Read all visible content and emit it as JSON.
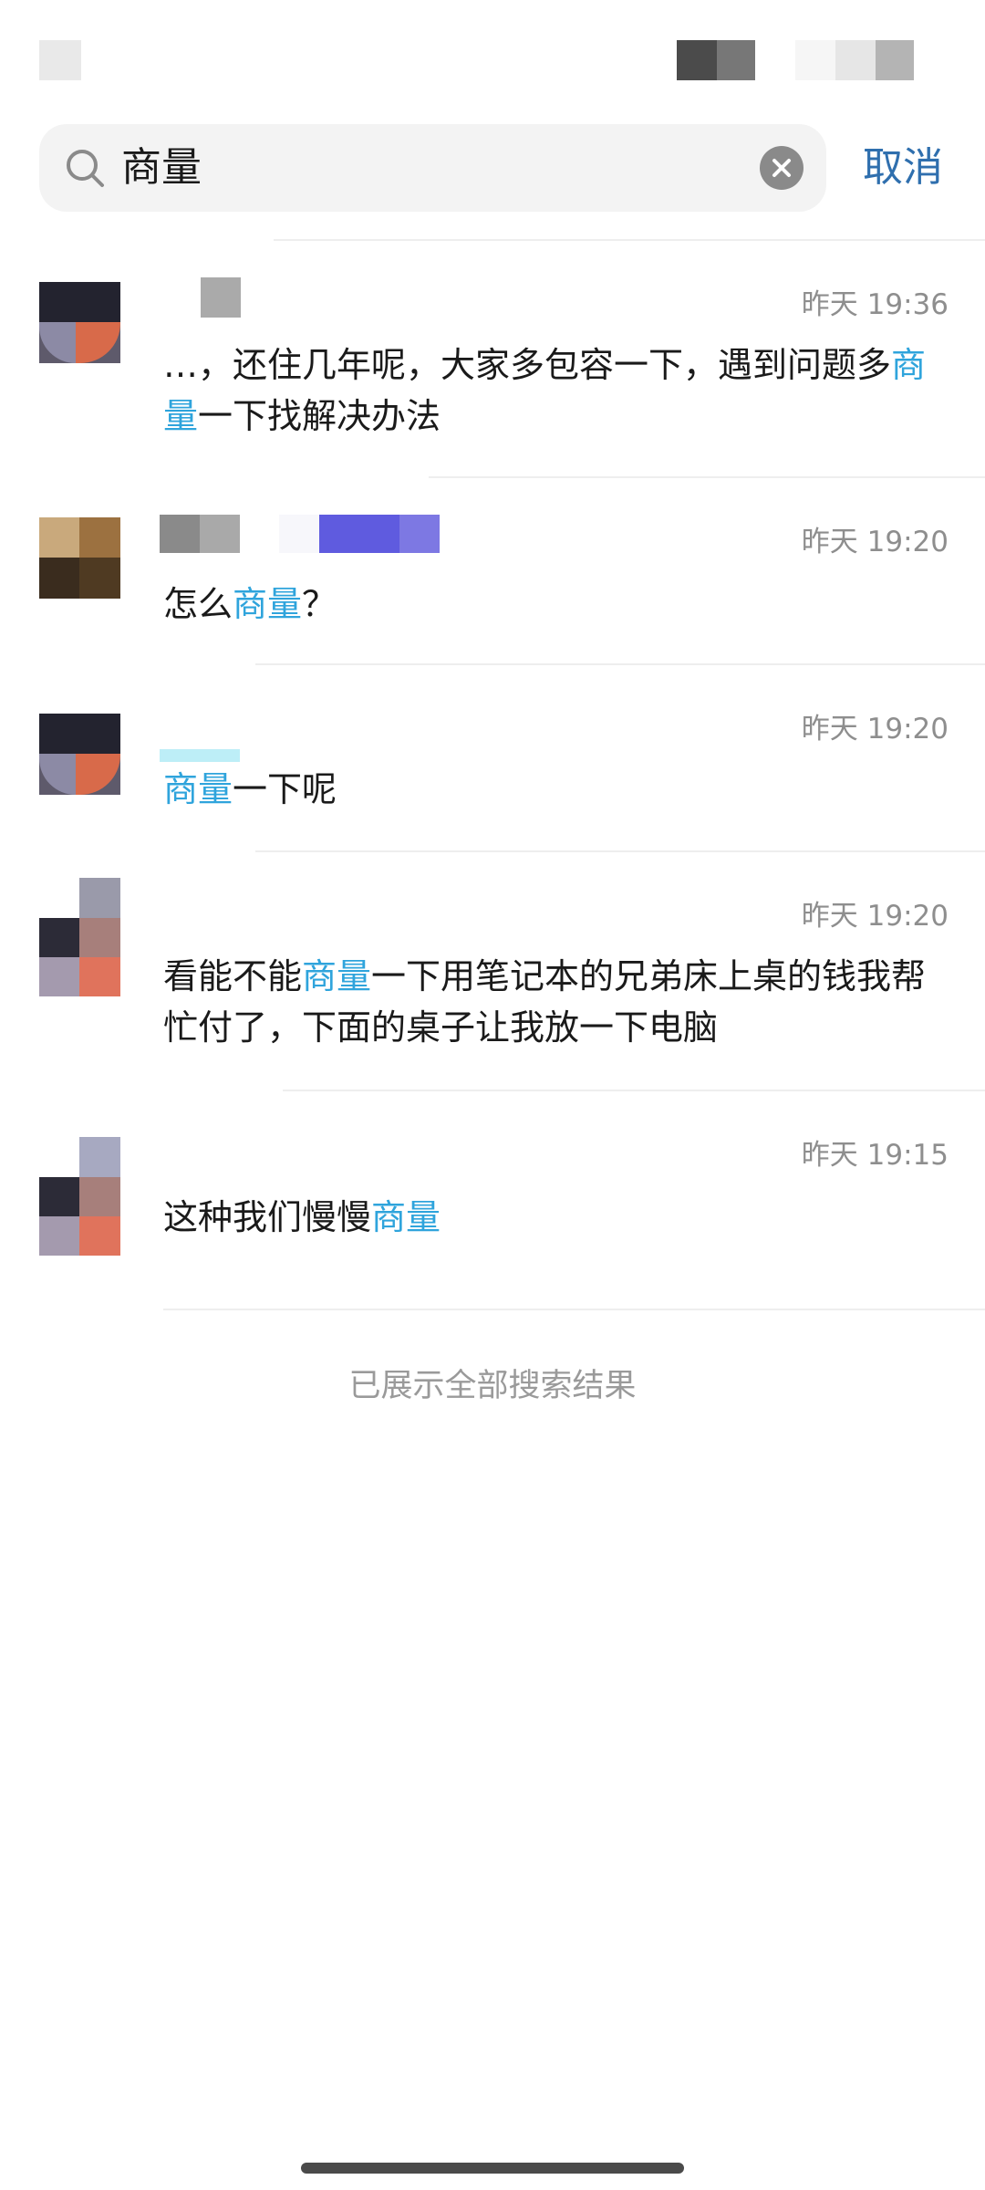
{
  "search": {
    "query": "商量",
    "cancel_label": "取消"
  },
  "results": [
    {
      "time": "昨天 19:36",
      "message_parts": [
        "…，还住几年呢，大家多包容一下，遇到问题多",
        "商量",
        "一下找解决办法"
      ]
    },
    {
      "time": "昨天 19:20",
      "message_parts": [
        "怎么",
        "商量",
        "？"
      ]
    },
    {
      "time": "昨天 19:20",
      "message_parts": [
        "",
        "商量",
        "一下呢"
      ]
    },
    {
      "time": "昨天 19:20",
      "message_parts": [
        "看能不能",
        "商量",
        "一下用笔记本的兄弟床上桌的钱我帮忙付了，下面的桌子让我放一下电脑"
      ]
    },
    {
      "time": "昨天 19:15",
      "message_parts": [
        "这种我们慢慢",
        "商量",
        ""
      ]
    }
  ],
  "footer": {
    "end_text": "已展示全部搜索结果"
  },
  "colors": {
    "highlight": "#2fa4dc",
    "cancel": "#2f6fae",
    "timestamp": "#8e8e8e"
  }
}
